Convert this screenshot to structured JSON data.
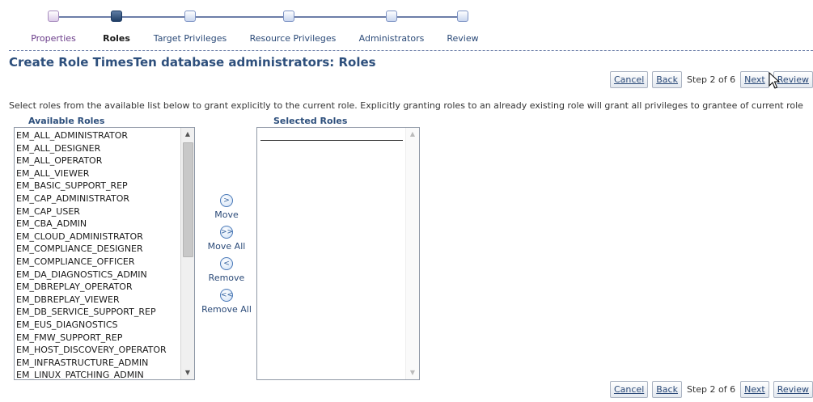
{
  "train": {
    "steps": [
      {
        "label": "Properties",
        "state": "visited"
      },
      {
        "label": "Roles",
        "state": "current"
      },
      {
        "label": "Target Privileges",
        "state": "pending"
      },
      {
        "label": "Resource Privileges",
        "state": "pending"
      },
      {
        "label": "Administrators",
        "state": "pending"
      },
      {
        "label": "Review",
        "state": "pending"
      }
    ]
  },
  "page": {
    "title": "Create Role TimesTen database administrators: Roles",
    "instructions": "Select roles from the available list below to grant explicitly to the current role. Explicitly granting roles to an already existing role will grant all privileges to grantee of current role"
  },
  "nav": {
    "cancel_label": "Cancel",
    "back_label": "Back",
    "step_text": "Step 2 of 6",
    "next_label": "Next",
    "review_label": "Review"
  },
  "shuttle": {
    "available_header": "Available Roles",
    "selected_header": "Selected Roles",
    "available_items": [
      "EM_ALL_ADMINISTRATOR",
      "EM_ALL_DESIGNER",
      "EM_ALL_OPERATOR",
      "EM_ALL_VIEWER",
      "EM_BASIC_SUPPORT_REP",
      "EM_CAP_ADMINISTRATOR",
      "EM_CAP_USER",
      "EM_CBA_ADMIN",
      "EM_CLOUD_ADMINISTRATOR",
      "EM_COMPLIANCE_DESIGNER",
      "EM_COMPLIANCE_OFFICER",
      "EM_DA_DIAGNOSTICS_ADMIN",
      "EM_DBREPLAY_OPERATOR",
      "EM_DBREPLAY_VIEWER",
      "EM_DB_SERVICE_SUPPORT_REP",
      "EM_EUS_DIAGNOSTICS",
      "EM_FMW_SUPPORT_REP",
      "EM_HOST_DISCOVERY_OPERATOR",
      "EM_INFRASTRUCTURE_ADMIN",
      "EM_LINUX_PATCHING_ADMIN"
    ],
    "selected_items": [],
    "buttons": {
      "move": {
        "label": "Move",
        "icon": "move-icon"
      },
      "move_all": {
        "label": "Move All",
        "icon": "move-all-icon"
      },
      "remove": {
        "label": "Remove",
        "icon": "remove-icon"
      },
      "remove_all": {
        "label": "Remove All",
        "icon": "remove-all-icon"
      }
    }
  },
  "colors": {
    "title": "#2d4f7c",
    "link": "#2b4a78",
    "train_visited": "#6b3d8a",
    "train_current": "#213f66"
  }
}
